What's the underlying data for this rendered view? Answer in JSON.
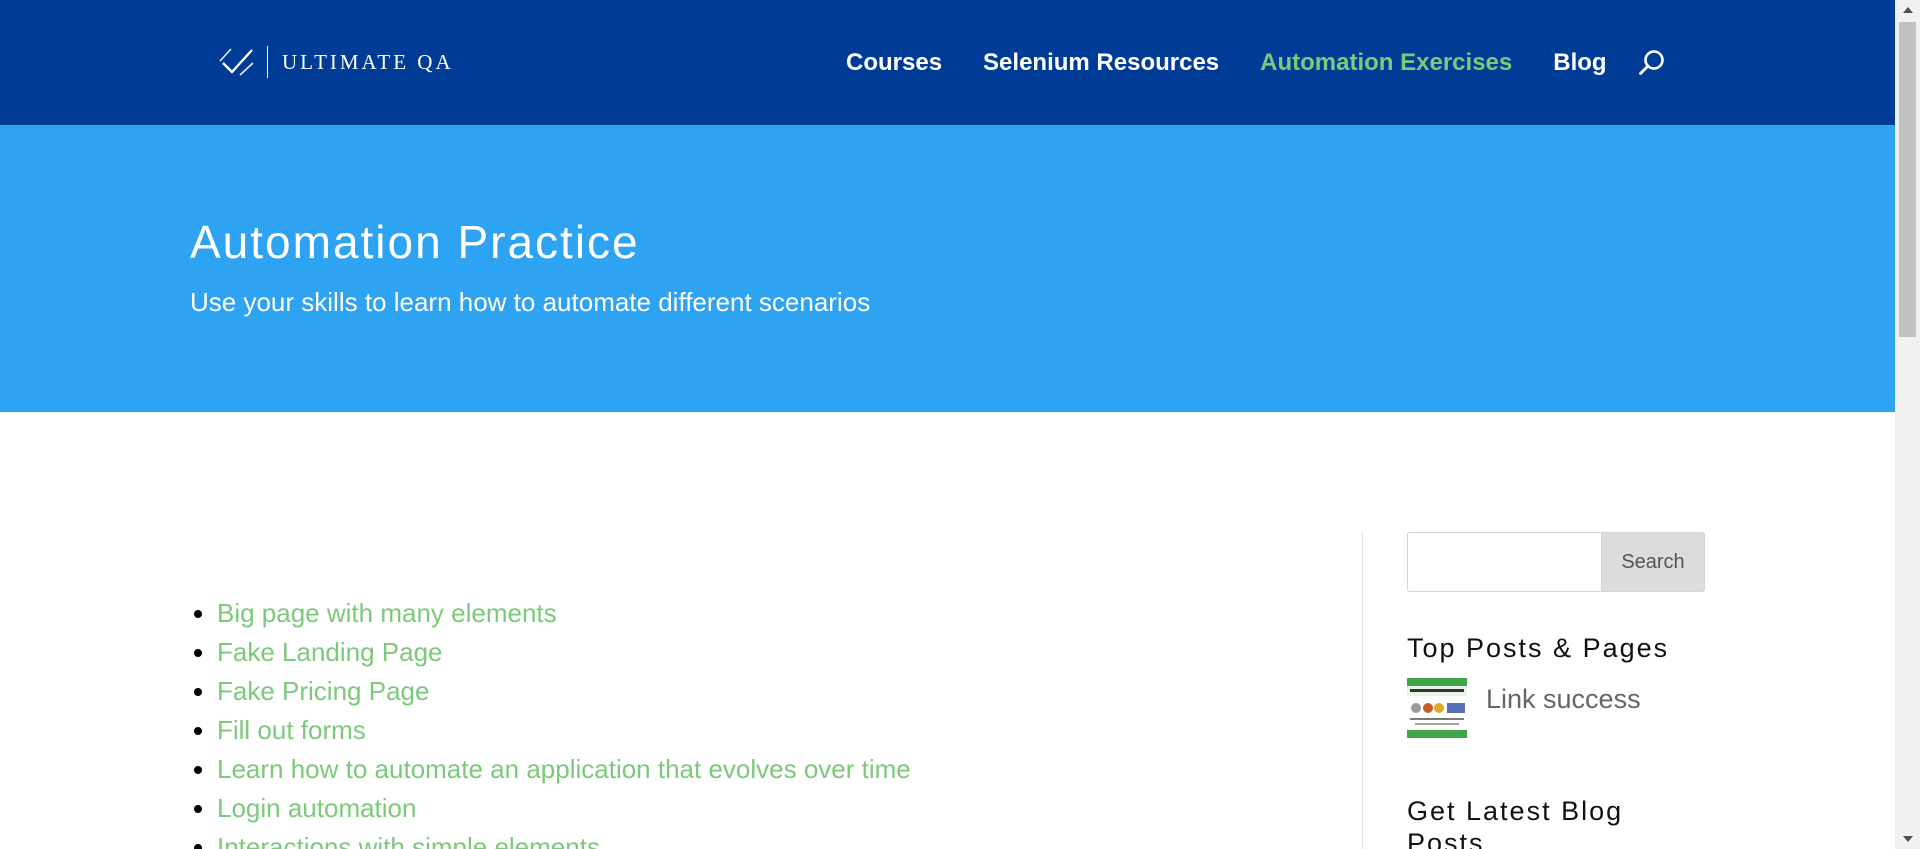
{
  "header": {
    "logo_text": "ULTIMATE QA",
    "logo_icon": "checkmark-icon",
    "nav": [
      {
        "label": "Courses",
        "active": false
      },
      {
        "label": "Selenium Resources",
        "active": false
      },
      {
        "label": "Automation Exercises",
        "active": true
      },
      {
        "label": "Blog",
        "active": false
      }
    ],
    "search_icon": "search-icon"
  },
  "hero": {
    "title": "Automation Practice",
    "subtitle": "Use your skills to learn how to automate different scenarios"
  },
  "main": {
    "links": [
      "Big page with many elements",
      "Fake Landing Page",
      "Fake Pricing Page",
      "Fill out forms",
      "Learn how to automate an application that evolves over time",
      "Login automation",
      "Interactions with simple elements"
    ]
  },
  "sidebar": {
    "search": {
      "value": "",
      "placeholder": "",
      "button_label": "Search"
    },
    "top_posts": {
      "title": "Top Posts & Pages",
      "items": [
        {
          "label": "Link success",
          "thumb_icon": "post-thumbnail-image"
        }
      ]
    },
    "latest": {
      "title": "Get Latest Blog Posts"
    }
  },
  "colors": {
    "header_bg": "#003b96",
    "hero_bg": "#2ea3f2",
    "accent_green": "#7cc97b",
    "search_button_bg": "#dcdcdc"
  }
}
